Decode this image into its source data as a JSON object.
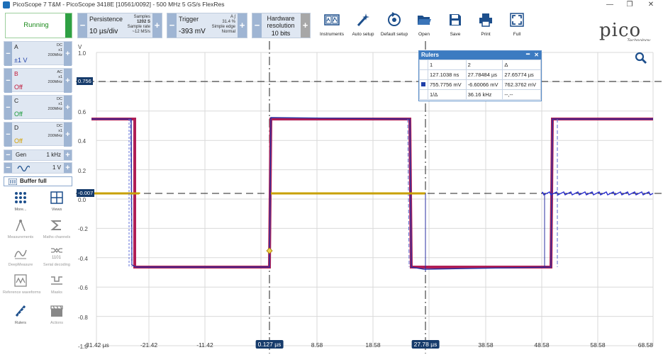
{
  "window": {
    "title": "PicoScope 7 T&M  - PicoScope 3418E [10561/0092] - 500 MHz 5 GS/s FlexRes",
    "min_label": "—",
    "restore_label": "❐",
    "close_label": "✕"
  },
  "toolbar": {
    "run_label": "Running",
    "persistence": {
      "label": "Persistence",
      "value": "10 µs/div",
      "samples_label": "Samples",
      "samples_value": "1202 S",
      "rate_label": "Sample rate",
      "rate_value": "~12 MS/s"
    },
    "trigger": {
      "label": "Trigger",
      "value": "-393 mV",
      "channel": "A",
      "percent": "31.4 %",
      "type": "Simple edge",
      "mode": "Normal"
    },
    "resolution": {
      "label": "Hardware resolution",
      "value": "10 bits"
    },
    "buttons": [
      {
        "key": "instruments",
        "label": "Instruments"
      },
      {
        "key": "auto-setup",
        "label": "Auto setup"
      },
      {
        "key": "default-setup",
        "label": "Default setup"
      },
      {
        "key": "open",
        "label": "Open"
      },
      {
        "key": "save",
        "label": "Save"
      },
      {
        "key": "print",
        "label": "Print"
      },
      {
        "key": "full",
        "label": "Full"
      }
    ],
    "logo": {
      "brand": "pico",
      "sub": "Technology"
    }
  },
  "channels": [
    {
      "name": "A",
      "range": "±1 V",
      "coupling": "DC",
      "probe": "x1",
      "bw": "200MHz",
      "color": "#1f3fa8"
    },
    {
      "name": "B",
      "range": "Off",
      "coupling": "AC",
      "probe": "x1",
      "bw": "200MHz",
      "color": "#c0183a"
    },
    {
      "name": "C",
      "range": "Off",
      "coupling": "DC",
      "probe": "x1",
      "bw": "200MHz",
      "color": "#1a9a3a"
    },
    {
      "name": "D",
      "range": "Off",
      "coupling": "DC",
      "probe": "x1",
      "bw": "200MHz",
      "color": "#d4a000"
    }
  ],
  "generator": {
    "label": "Gen",
    "freq": "1 kHz",
    "amp": "1 V"
  },
  "buffer_label": "Buffer full",
  "side_buttons": [
    {
      "label": "More...",
      "icon": "grid-dots-icon"
    },
    {
      "label": "Views",
      "icon": "views-icon"
    },
    {
      "label": "Measurements",
      "icon": "measurements-icon"
    },
    {
      "label": "Maths channels",
      "icon": "sigma-icon"
    },
    {
      "label": "DeepMeasure",
      "icon": "deepmeasure-icon"
    },
    {
      "label": "Serial decoding",
      "icon": "serial-icon"
    },
    {
      "label": "Reference waveforms",
      "icon": "reference-icon"
    },
    {
      "label": "Masks",
      "icon": "masks-icon"
    },
    {
      "label": "Rulers",
      "icon": "ruler-icon"
    },
    {
      "label": "Actions",
      "icon": "actions-icon"
    }
  ],
  "plot": {
    "y_unit": "V",
    "y_ticks": [
      "1.0",
      "0.8",
      "0.6",
      "0.4",
      "0.2",
      "0.0",
      "-0.2",
      "-0.4",
      "-0.6",
      "-0.8",
      "-1.0"
    ],
    "x_ticks": [
      "-31.42 µs",
      "-21.42",
      "-11.42",
      "8.58",
      "18.58",
      "38.58",
      "48.58",
      "58.58",
      "68.58"
    ],
    "time_rulers": [
      "0.127 µs",
      "27.78 µs"
    ],
    "voltage_rulers": [
      "0.756",
      "-0.007"
    ]
  },
  "rulers_panel": {
    "title": "Rulers",
    "headers": [
      "1",
      "2",
      "Δ"
    ],
    "time_row": [
      "127.1038 ns",
      "27.78484 µs",
      "27.65774 µs"
    ],
    "volt_row": [
      "755.7756 mV",
      "-6.60066 mV",
      "762.3762 mV"
    ],
    "freq_label": "1/Δ",
    "freq_value": "36.16 kHz",
    "freq_extra": "--,--"
  }
}
